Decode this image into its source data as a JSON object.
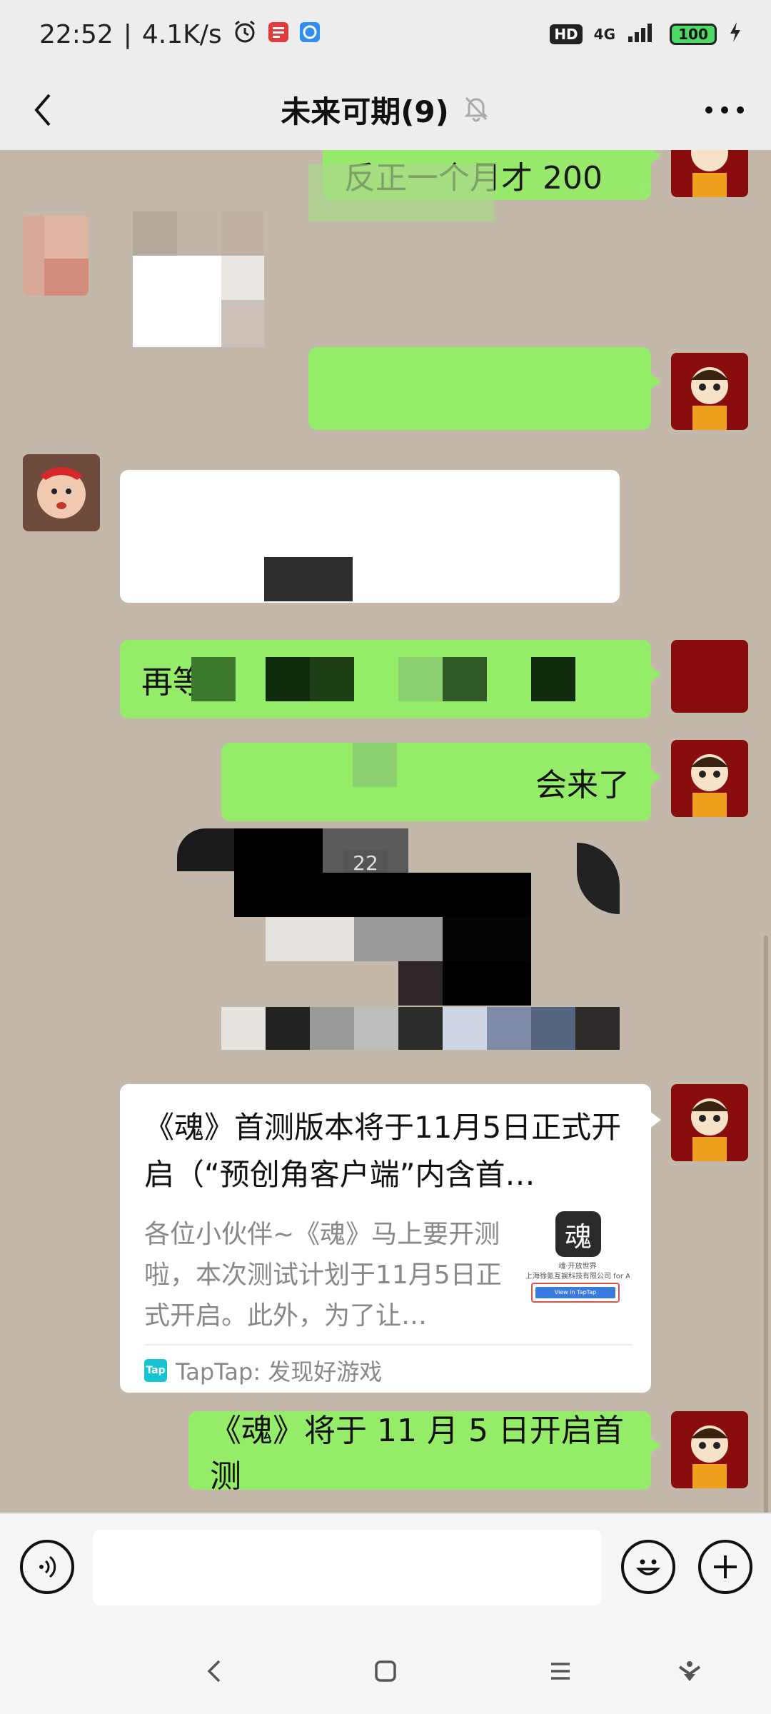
{
  "status_bar": {
    "time": "22:52",
    "separator": "|",
    "net_speed": "4.1K/s",
    "hd": "HD",
    "network": "4G",
    "battery": "100"
  },
  "header": {
    "title": "未来可期(9)"
  },
  "messages": {
    "m1_text": "反正一个月才 200",
    "m5_text": "再等",
    "m6_text": "会来了",
    "photo_time": "22"
  },
  "card": {
    "title": "《魂》首测版本将于11月5日正式开启（“预创角客户端”内含首…",
    "description": "各位小伙伴~《魂》马上要开测啦，本次测试计划于11月5日正式开启。此外，为了让…",
    "thumb_title": "魂",
    "thumb_line1": "魂·开放世界",
    "thumb_line2": "上海徐氪互娱科技有限公司 for A",
    "thumb_button": "View in TapTap",
    "logo_text": "Tap",
    "source": "TapTap: 发现好游戏"
  },
  "last_message": {
    "text": "《魂》将于 11 月 5 日开启首测"
  },
  "input_bar": {
    "placeholder": ""
  }
}
